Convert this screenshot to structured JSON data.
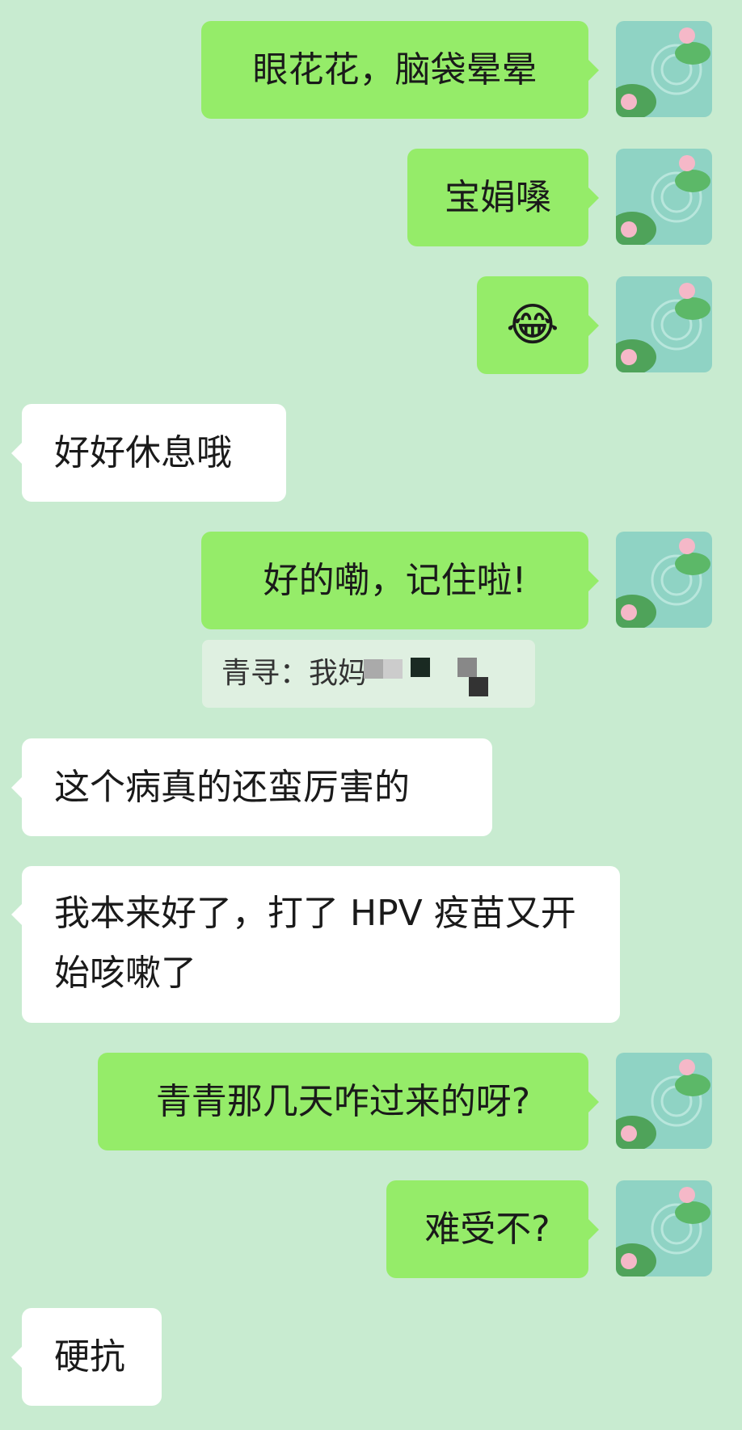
{
  "messages": [
    {
      "from": "me",
      "text": "眼花花，脑袋晕晕"
    },
    {
      "from": "me",
      "text": "宝娟嗓"
    },
    {
      "from": "me",
      "text": "😂",
      "icon": "laughing-tears-emoji"
    },
    {
      "from": "them",
      "text": "好好休息哦"
    },
    {
      "from": "me",
      "text": "好的嘞，记住啦!"
    },
    {
      "from": "them",
      "text": "这个病真的还蛮厉害的"
    },
    {
      "from": "them",
      "text": "我本来好了，打了 HPV 疫苗又开始咳嗽了"
    },
    {
      "from": "me",
      "text": "青青那几天咋过来的呀?"
    },
    {
      "from": "me",
      "text": "难受不?"
    },
    {
      "from": "them",
      "text": "硬抗"
    }
  ],
  "quote": {
    "text": "青寻：我妈"
  },
  "colors": {
    "background": "#c8ebd0",
    "my_bubble": "#95ec69",
    "their_bubble": "#ffffff"
  },
  "avatar": {
    "icon": "lotus-pond-avatar"
  }
}
